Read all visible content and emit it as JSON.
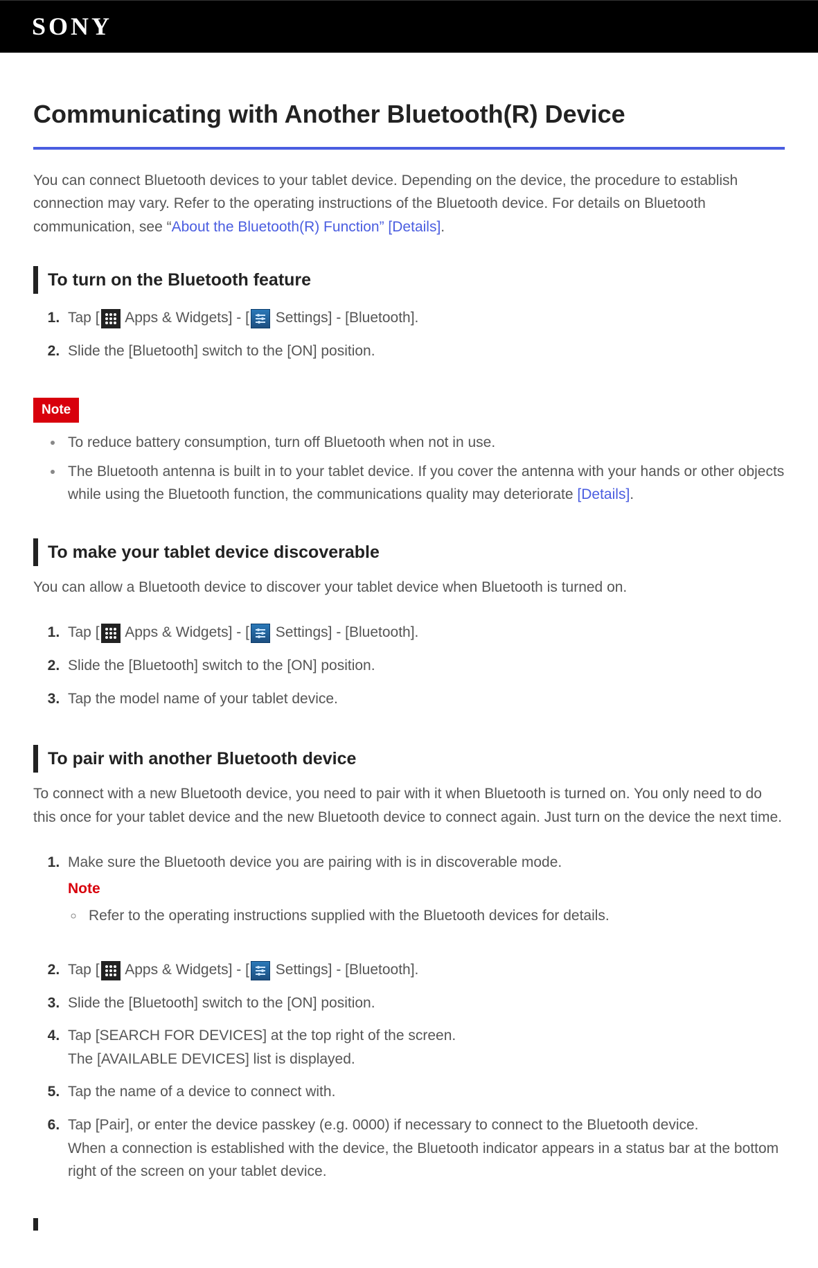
{
  "logo": "SONY",
  "title": "Communicating with Another Bluetooth(R) Device",
  "intro": {
    "prefix": "You can connect Bluetooth devices to your tablet device. Depending on the device, the procedure to establish connection may vary. Refer to the operating instructions of the Bluetooth device. For details on Bluetooth communication, see “",
    "link_text": "About the Bluetooth(R) Function” [Details]",
    "suffix": "."
  },
  "section_turn_on": {
    "heading": "To turn on the Bluetooth feature",
    "step1": {
      "p1": "Tap [",
      "p2": " Apps & Widgets] - [",
      "p3": " Settings] - [Bluetooth]."
    },
    "step2": "Slide the [Bluetooth] switch to the [ON] position."
  },
  "note_label": "Note",
  "note_bullets": {
    "b1": "To reduce battery consumption, turn off Bluetooth when not in use.",
    "b2_pre": "The Bluetooth antenna is built in to your tablet device. If you cover the antenna with your hands or other objects while using the Bluetooth function, the communications quality may deteriorate ",
    "b2_link": "[Details]",
    "b2_post": "."
  },
  "section_discoverable": {
    "heading": "To make your tablet device discoverable",
    "intro": "You can allow a Bluetooth device to discover your tablet device when Bluetooth is turned on.",
    "step1": {
      "p1": "Tap [",
      "p2": " Apps & Widgets] - [",
      "p3": " Settings] - [Bluetooth]."
    },
    "step2": "Slide the [Bluetooth] switch to the [ON] position.",
    "step3": "Tap the model name of your tablet device."
  },
  "section_pair": {
    "heading": "To pair with another Bluetooth device",
    "intro": "To connect with a new Bluetooth device, you need to pair with it when Bluetooth is turned on. You only need to do this once for your tablet device and the new Bluetooth device to connect again. Just turn on the device the next time.",
    "step1": {
      "text": "Make sure the Bluetooth device you are pairing with is in discoverable mode.",
      "note_label": "Note",
      "sub": "Refer to the operating instructions supplied with the Bluetooth devices for details."
    },
    "step2": {
      "p1": "Tap [",
      "p2": " Apps & Widgets] - [",
      "p3": " Settings] - [Bluetooth]."
    },
    "step3": "Slide the [Bluetooth] switch to the [ON] position.",
    "step4_l1": "Tap [SEARCH FOR DEVICES] at the top right of the screen.",
    "step4_l2": "The [AVAILABLE DEVICES] list is displayed.",
    "step5": "Tap the name of a device to connect with.",
    "step6_l1": "Tap [Pair], or enter the device passkey (e.g. 0000) if necessary to connect to the Bluetooth device.",
    "step6_l2": "When a connection is established with the device, the Bluetooth indicator appears in a status bar at the bottom right of the screen on your tablet device."
  }
}
